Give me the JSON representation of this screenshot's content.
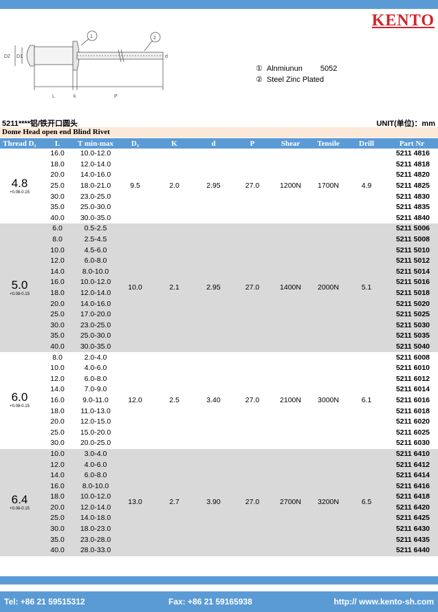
{
  "brand": {
    "logo": "KENTO"
  },
  "legend": [
    {
      "num": "①",
      "material": "Alnmiunun",
      "grade": "5052"
    },
    {
      "num": "②",
      "material": "Steel Zinc Plated",
      "grade": ""
    }
  ],
  "drawing": {
    "labels": [
      "D2",
      "D1",
      "L",
      "k",
      "P",
      "d",
      "1",
      "2"
    ]
  },
  "heading": {
    "series": "5211****铝/铁开口圆头",
    "unit": "UNIT(单位)：mm",
    "subtitle": "Dome Head open end Blind Rivet"
  },
  "columns": [
    "Thread D₁",
    "L",
    "T min-max",
    "D₂",
    "K",
    "d",
    "P",
    "Shear",
    "Tensile",
    "Drill",
    "Part Nr"
  ],
  "groups": [
    {
      "thread": "4.8",
      "tol": "+0.08-0.15",
      "D2": "9.5",
      "K": "2.0",
      "d": "2.95",
      "P": "27.0",
      "shear": "1200N",
      "tensile": "1700N",
      "drill": "4.9",
      "shade": false,
      "rows": [
        [
          "16.0",
          "10.0-12.0",
          "5211 4816"
        ],
        [
          "18.0",
          "12.0-14.0",
          "5211 4818"
        ],
        [
          "20.0",
          "14.0-16.0",
          "5211 4820"
        ],
        [
          "25.0",
          "18.0-21.0",
          "5211 4825"
        ],
        [
          "30.0",
          "23.0-25.0",
          "5211 4830"
        ],
        [
          "35.0",
          "25.0-30.0",
          "5211 4835"
        ],
        [
          "40.0",
          "30.0-35.0",
          "5211 4840"
        ]
      ]
    },
    {
      "thread": "5.0",
      "tol": "+0.08-0.15",
      "D2": "10.0",
      "K": "2.1",
      "d": "2.95",
      "P": "27.0",
      "shear": "1400N",
      "tensile": "2000N",
      "drill": "5.1",
      "shade": true,
      "rows": [
        [
          "6.0",
          "0.5-2.5",
          "5211 5006"
        ],
        [
          "8.0",
          "2.5-4.5",
          "5211 5008"
        ],
        [
          "10.0",
          "4.5-6.0",
          "5211 5010"
        ],
        [
          "12.0",
          "6.0-8.0",
          "5211 5012"
        ],
        [
          "14.0",
          "8.0-10.0",
          "5211 5014"
        ],
        [
          "16.0",
          "10.0-12.0",
          "5211 5016"
        ],
        [
          "18.0",
          "12.0-14.0",
          "5211 5018"
        ],
        [
          "20.0",
          "14.0-16.0",
          "5211 5020"
        ],
        [
          "25.0",
          "17.0-20.0",
          "5211 5025"
        ],
        [
          "30.0",
          "23.0-25.0",
          "5211 5030"
        ],
        [
          "35.0",
          "25.0-30.0",
          "5211 5035"
        ],
        [
          "40.0",
          "30.0-35.0",
          "5211 5040"
        ]
      ]
    },
    {
      "thread": "6.0",
      "tol": "+0.08-0.15",
      "D2": "12.0",
      "K": "2.5",
      "d": "3.40",
      "P": "27.0",
      "shear": "2100N",
      "tensile": "3000N",
      "drill": "6.1",
      "shade": false,
      "rows": [
        [
          "8.0",
          "2.0-4.0",
          "5211 6008"
        ],
        [
          "10.0",
          "4.0-6.0",
          "5211 6010"
        ],
        [
          "12.0",
          "6.0-8.0",
          "5211 6012"
        ],
        [
          "14.0",
          "7.0-9.0",
          "5211 6014"
        ],
        [
          "16.0",
          "9.0-11.0",
          "5211 6016"
        ],
        [
          "18.0",
          "11.0-13.0",
          "5211 6018"
        ],
        [
          "20.0",
          "12.0-15.0",
          "5211 6020"
        ],
        [
          "25.0",
          "15.0-20.0",
          "5211 6025"
        ],
        [
          "30.0",
          "20.0-25.0",
          "5211 6030"
        ]
      ]
    },
    {
      "thread": "6.4",
      "tol": "+0.08-0.15",
      "D2": "13.0",
      "K": "2.7",
      "d": "3.90",
      "P": "27.0",
      "shear": "2700N",
      "tensile": "3200N",
      "drill": "6.5",
      "shade": true,
      "rows": [
        [
          "10.0",
          "3.0-4.0",
          "5211 6410"
        ],
        [
          "12.0",
          "4.0-6.0",
          "5211 6412"
        ],
        [
          "14.0",
          "6.0-8.0",
          "5211 6414"
        ],
        [
          "16.0",
          "8.0-10.0",
          "5211 6416"
        ],
        [
          "18.0",
          "10.0-12.0",
          "5211 6418"
        ],
        [
          "20.0",
          "12.0-14.0",
          "5211 6420"
        ],
        [
          "25.0",
          "14.0-18.0",
          "5211 6425"
        ],
        [
          "30.0",
          "18.0-23.0",
          "5211 6430"
        ],
        [
          "35.0",
          "23.0-28.0",
          "5211 6435"
        ],
        [
          "40.0",
          "28.0-33.0",
          "5211 6440"
        ]
      ]
    }
  ],
  "footer": {
    "tel": "Tel: +86 21 59515312",
    "fax": "Fax: +86 21 59165938",
    "web": "http:// www.kento-sh.com"
  },
  "colors": {
    "band": "#5b9bd5",
    "shade": "#d9d9d9",
    "subtitle_bg": "#fde9d9",
    "logo": "#d4232a"
  }
}
